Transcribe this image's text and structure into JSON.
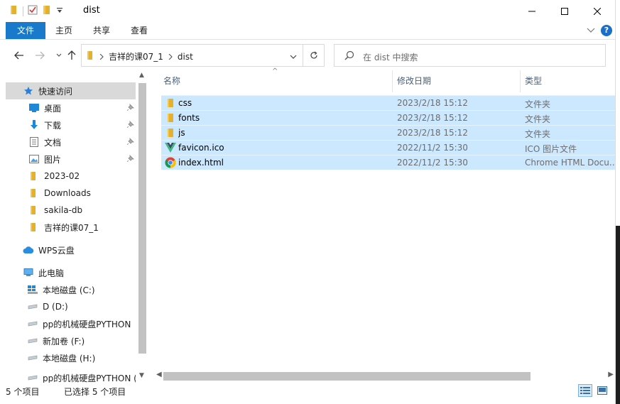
{
  "window": {
    "title": "dist",
    "minimize_icon": "minimize-icon",
    "maximize_icon": "maximize-icon",
    "close_icon": "close-icon"
  },
  "ribbon": {
    "tabs": [
      "文件",
      "主页",
      "共享",
      "查看"
    ],
    "active_color": "#1979ca"
  },
  "address": {
    "path": [
      "吉祥的课07_1",
      "dist"
    ],
    "search_placeholder": "在 dist 中搜索"
  },
  "nav_pane": {
    "quick_access": "快速访问",
    "items": [
      {
        "label": "桌面",
        "icon": "desktop-icon",
        "pinned": true
      },
      {
        "label": "下载",
        "icon": "download-icon",
        "pinned": true
      },
      {
        "label": "文档",
        "icon": "documents-icon",
        "pinned": true
      },
      {
        "label": "图片",
        "icon": "pictures-icon",
        "pinned": true
      },
      {
        "label": "2023-02",
        "icon": "folder-icon",
        "pinned": false
      },
      {
        "label": "Downloads",
        "icon": "folder-icon",
        "pinned": false
      },
      {
        "label": "sakila-db",
        "icon": "folder-icon",
        "pinned": false
      },
      {
        "label": "吉祥的课07_1",
        "icon": "folder-icon",
        "pinned": false
      }
    ],
    "wps": "WPS云盘",
    "this_pc": "此电脑",
    "drives": [
      "本地磁盘 (C:)",
      "D (D:)",
      "pp的机械硬盘PYTHON",
      "新加卷 (F:)",
      "本地磁盘 (H:)",
      "pp的机械硬盘PYTHON (F"
    ]
  },
  "columns": {
    "name": "名称",
    "date": "修改日期",
    "type": "类型"
  },
  "files": [
    {
      "name": "css",
      "date": "2023/2/18 15:12",
      "type": "文件夹",
      "icon": "folder-icon"
    },
    {
      "name": "fonts",
      "date": "2023/2/18 15:12",
      "type": "文件夹",
      "icon": "folder-icon"
    },
    {
      "name": "js",
      "date": "2023/2/18 15:12",
      "type": "文件夹",
      "icon": "folder-icon"
    },
    {
      "name": "favicon.ico",
      "date": "2022/11/2 15:30",
      "type": "ICO 图片文件",
      "icon": "vue-logo-icon"
    },
    {
      "name": "index.html",
      "date": "2022/11/2 15:30",
      "type": "Chrome HTML Docu...",
      "icon": "chrome-icon"
    }
  ],
  "status": {
    "count": "5 个项目",
    "selected": "已选择 5 个项目"
  }
}
